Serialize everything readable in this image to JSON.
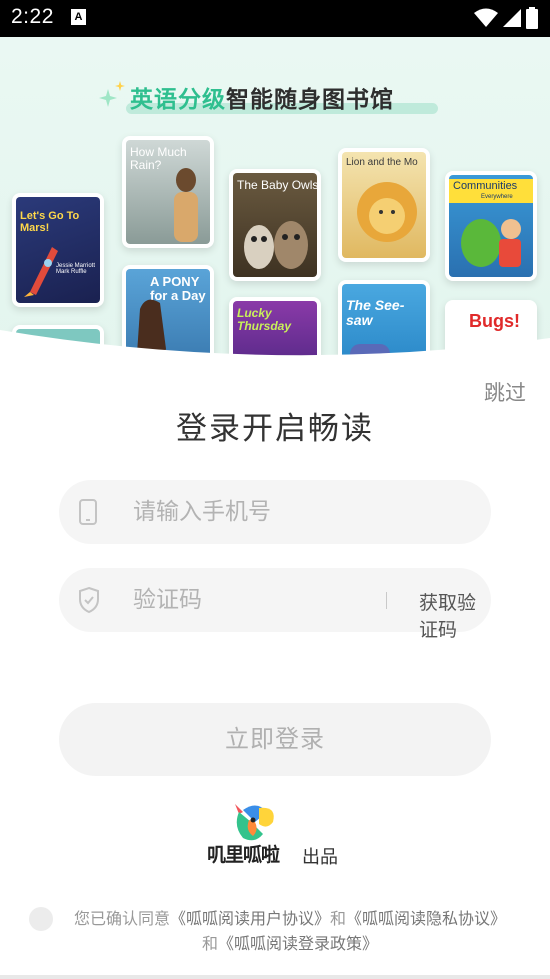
{
  "status_bar": {
    "time": "2:22",
    "notification_icon": "A"
  },
  "banner": {
    "title_highlight": "英语分级",
    "title_rest": "智能随身图书馆",
    "books": [
      {
        "title": "Let's Go To Mars!",
        "byline": "Jessie Marriott  Mark Ruffle"
      },
      {
        "title": "How Much Rain?"
      },
      {
        "title": "A PONY for a Day"
      },
      {
        "title": "The Baby Owls"
      },
      {
        "title": "Lucky Thursday"
      },
      {
        "title": "Lion and the Mo"
      },
      {
        "title": "The See-saw"
      },
      {
        "title": "Communities",
        "subtitle": "Everywhere"
      },
      {
        "title": "Bugs!"
      }
    ]
  },
  "login": {
    "skip": "跳过",
    "title": "登录开启畅读",
    "phone_placeholder": "请输入手机号",
    "code_placeholder": "验证码",
    "get_code": "获取验证码",
    "submit": "立即登录"
  },
  "brand": {
    "name": "叽里呱啦",
    "suffix": "出品"
  },
  "agreement": {
    "prefix": "您已确认同意",
    "user_agreement": "《呱呱阅读用户协议》",
    "and1": "和",
    "privacy_agreement": "《呱呱阅读隐私协议》",
    "and2": "和",
    "login_policy": "《呱呱阅读登录政策》"
  },
  "colors": {
    "accent": "#2fbf8f",
    "banner_bg": "#e6f7f0",
    "field_bg": "#f5f5f5"
  }
}
